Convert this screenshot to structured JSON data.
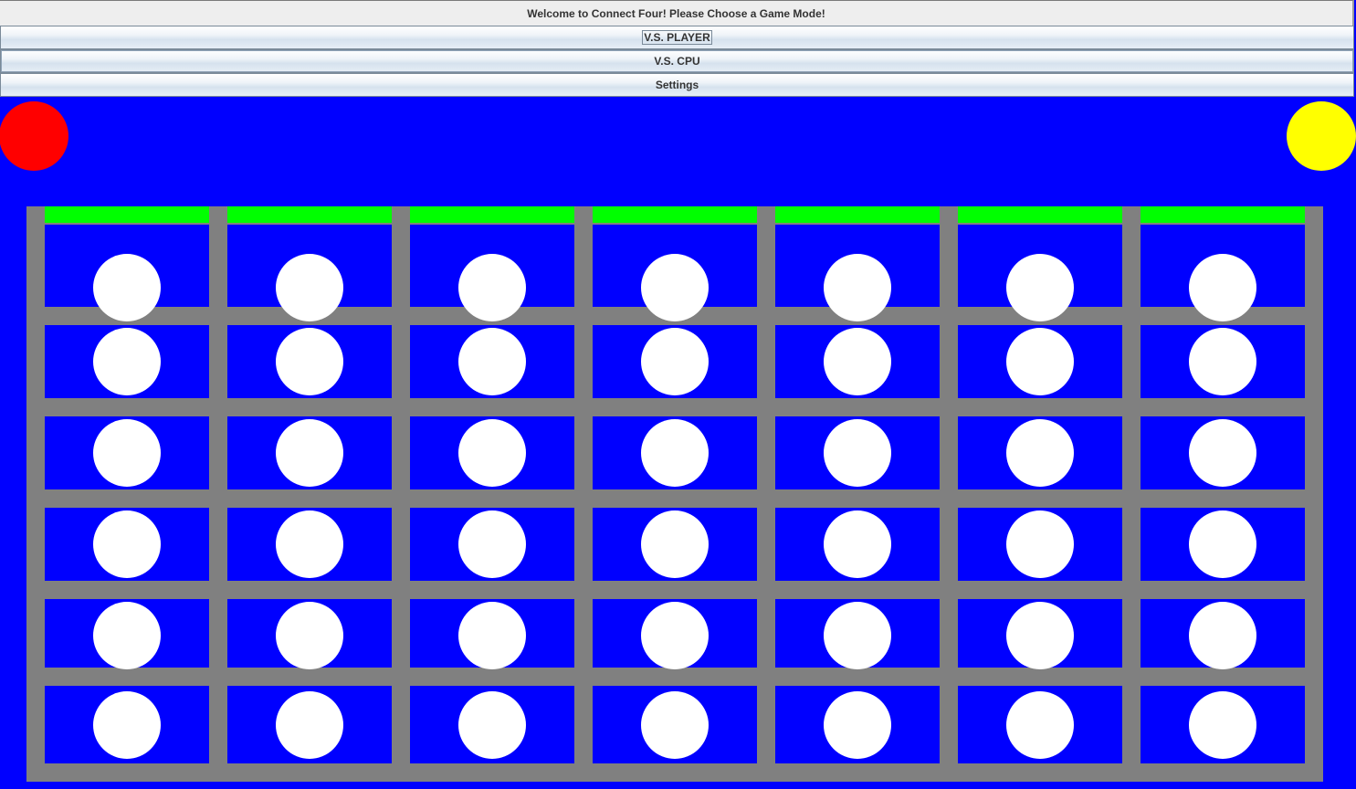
{
  "header": {
    "welcome_text": "Welcome to Connect Four! Please Choose a Game Mode!"
  },
  "menu": {
    "vs_player_label": "V.S. PLAYER",
    "vs_cpu_label": "V.S. CPU",
    "settings_label": "Settings"
  },
  "players": {
    "player1_color": "#ff0000",
    "player2_color": "#ffff00"
  },
  "board": {
    "columns": 7,
    "rows": 6,
    "cells": [
      [
        "empty",
        "empty",
        "empty",
        "empty",
        "empty",
        "empty",
        "empty"
      ],
      [
        "empty",
        "empty",
        "empty",
        "empty",
        "empty",
        "empty",
        "empty"
      ],
      [
        "empty",
        "empty",
        "empty",
        "empty",
        "empty",
        "empty",
        "empty"
      ],
      [
        "empty",
        "empty",
        "empty",
        "empty",
        "empty",
        "empty",
        "empty"
      ],
      [
        "empty",
        "empty",
        "empty",
        "empty",
        "empty",
        "empty",
        "empty"
      ],
      [
        "empty",
        "empty",
        "empty",
        "empty",
        "empty",
        "empty",
        "empty"
      ]
    ],
    "frame_color": "#808080",
    "cell_color": "#0000ff",
    "empty_color": "#ffffff",
    "drop_indicator_color": "#00ff00"
  }
}
